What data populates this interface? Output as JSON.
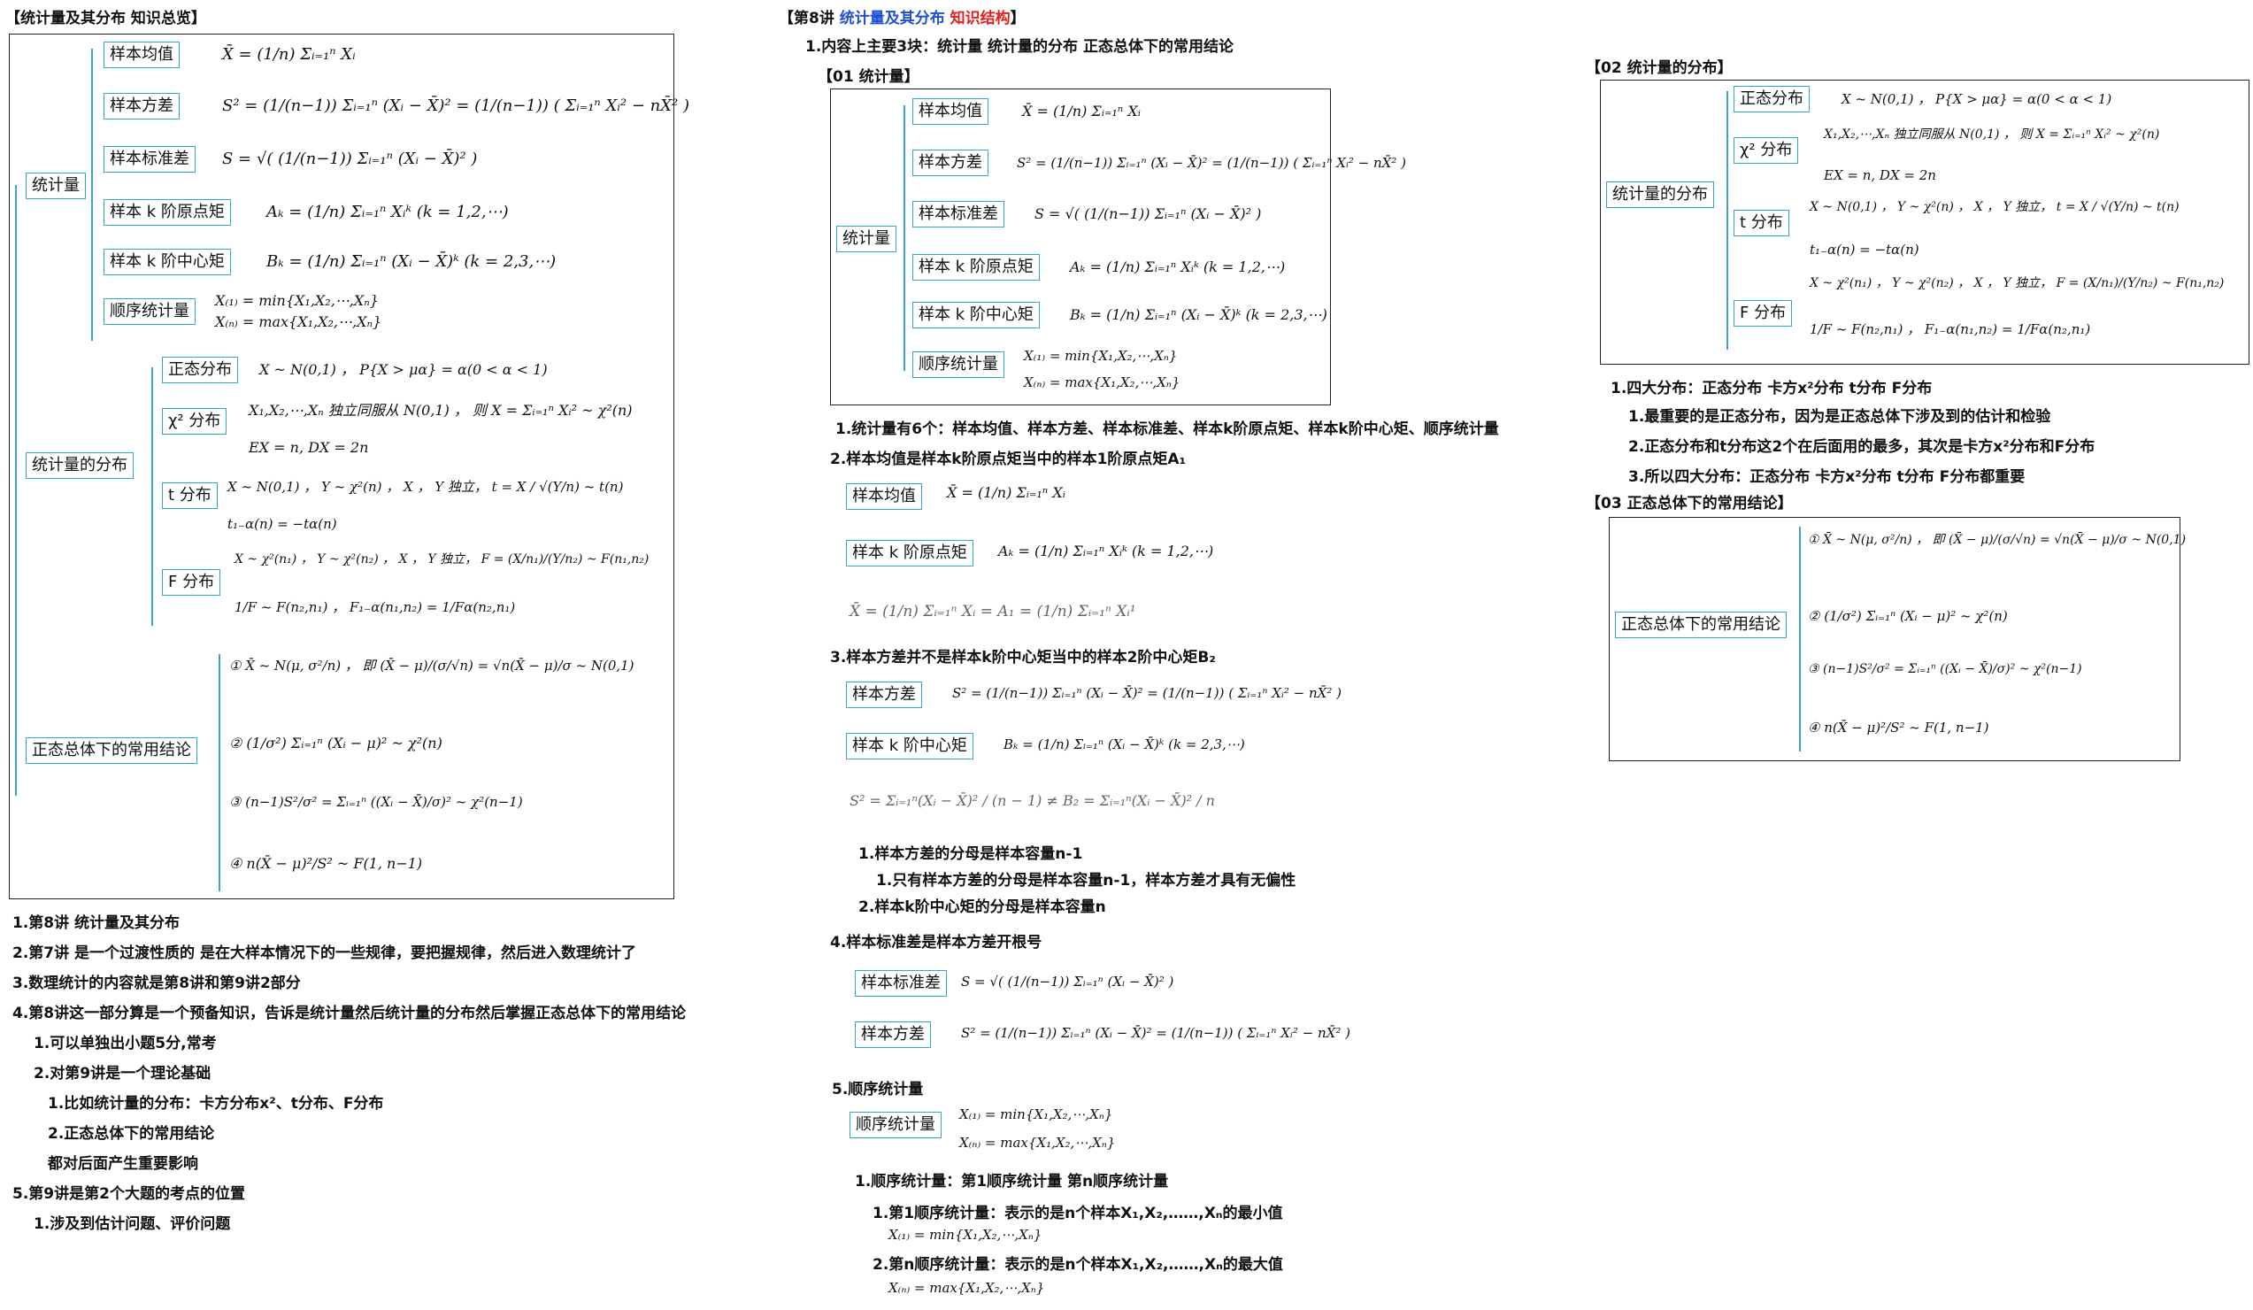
{
  "left": {
    "header": "【统计量及其分布 知识总览】",
    "tree": {
      "stat": "统计量",
      "stat_items": [
        "样本均值",
        "样本方差",
        "样本标准差",
        "样本 k 阶原点矩",
        "样本 k 阶中心矩",
        "顺序统计量"
      ],
      "stat_formulas": [
        "X̄ = (1/n) Σᵢ₌₁ⁿ Xᵢ",
        "S² = (1/(n−1)) Σᵢ₌₁ⁿ (Xᵢ − X̄)² = (1/(n−1)) ( Σᵢ₌₁ⁿ Xᵢ² − nX̄² )",
        "S = √( (1/(n−1)) Σᵢ₌₁ⁿ (Xᵢ − X̄)² )",
        "Aₖ = (1/n) Σᵢ₌₁ⁿ Xᵢᵏ (k = 1,2,⋯)",
        "Bₖ = (1/n) Σᵢ₌₁ⁿ (Xᵢ − X̄)ᵏ (k = 2,3,⋯)",
        "X₍₁₎ = min{X₁,X₂,⋯,Xₙ}",
        "X₍ₙ₎ = max{X₁,X₂,⋯,Xₙ}"
      ],
      "dist": "统计量的分布",
      "dist_items": [
        "正态分布",
        "χ² 分布",
        "t 分布",
        "F 分布"
      ],
      "dist_formulas": [
        "X ~ N(0,1) ， P{X > μα} = α(0 < α < 1)",
        "X₁,X₂,⋯,Xₙ 独立同服从 N(0,1) ， 则 X = Σᵢ₌₁ⁿ Xᵢ² ~ χ²(n)",
        "EX = n, DX = 2n",
        "X ~ N(0,1) ， Y ~ χ²(n) ， X ， Y 独立， t = X / √(Y/n) ~ t(n)",
        "t₁₋α(n) = −tα(n)",
        "X ~ χ²(n₁) ， Y ~ χ²(n₂) ， X ， Y 独立， F = (X/n₁)/(Y/n₂) ~ F(n₁,n₂)",
        "1/F ~ F(n₂,n₁) ， F₁₋α(n₁,n₂) = 1/Fα(n₂,n₁)"
      ],
      "normal": "正态总体下的常用结论",
      "normal_formulas": [
        "① X̄ ~ N(μ, σ²/n) ， 即 (X̄ − μ)/(σ/√n) = √n(X̄ − μ)/σ ~ N(0,1)",
        "② (1/σ²) Σᵢ₌₁ⁿ (Xᵢ − μ)² ~ χ²(n)",
        "③ (n−1)S²/σ² = Σᵢ₌₁ⁿ ((Xᵢ − X̄)/σ)² ~ χ²(n−1)",
        "④ n(X̄ − μ)²/S² ~ F(1, n−1)"
      ]
    },
    "notes": [
      "1.第8讲 统计量及其分布",
      "2.第7讲 是一个过渡性质的 是在大样本情况下的一些规律，要把握规律，然后进入数理统计了",
      "3.数理统计的内容就是第8讲和第9讲2部分",
      "4.第8讲这一部分算是一个预备知识，告诉是统计量然后统计量的分布然后掌握正态总体下的常用结论",
      "1.可以单独出小题5分,常考",
      "2.对第9讲是一个理论基础",
      "1.比如统计量的分布：卡方分布x²、t分布、F分布",
      "2.正态总体下的常用结论",
      "都对后面产生重要影响",
      "5.第9讲是第2个大题的考点的位置",
      "1.涉及到估计问题、评价问题"
    ]
  },
  "middle": {
    "header_a": "【第8讲 ",
    "header_b": "统计量及其分布 ",
    "header_c": "知识结构",
    "header_d": "】",
    "line1": "1.内容上主要3块：统计量 统计量的分布 正态总体下的常用结论",
    "sub01": "【01 统计量】",
    "note1": "1.统计量有6个：样本均值、样本方差、样本标准差、样本k阶原点矩、样本k阶中心矩、顺序统计量",
    "note2": "2.样本均值是样本k阶原点矩当中的样本1阶原点矩A₁",
    "eq_mean_a1": "X̄ = (1/n) Σᵢ₌₁ⁿ Xᵢ = A₁ = (1/n) Σᵢ₌₁ⁿ Xᵢ¹",
    "note3": "3.样本方差并不是样本k阶中心矩当中的样本2阶中心矩B₂",
    "eq_s2_b2": "S² = Σᵢ₌₁ⁿ(Xᵢ − X̄)² / (n − 1) ≠ B₂ = Σᵢ₌₁ⁿ(Xᵢ − X̄)² / n",
    "note3a": "1.样本方差的分母是样本容量n-1",
    "note3b": "1.只有样本方差的分母是样本容量n-1，样本方差才具有无偏性",
    "note3c": "2.样本k阶中心矩的分母是样本容量n",
    "note4": "4.样本标准差是样本方差开根号",
    "note5": "5.顺序统计量",
    "note5a": "1.顺序统计量：第1顺序统计量 第n顺序统计量",
    "note5b": "1.第1顺序统计量：表示的是n个样本X₁,X₂,……,Xₙ的最小值",
    "note5b_f": "X₍₁₎ = min{X₁,X₂,⋯,Xₙ}",
    "note5c": "2.第n顺序统计量：表示的是n个样本X₁,X₂,……,Xₙ的最大值",
    "note5c_f": "X₍ₙ₎ = max{X₁,X₂,⋯,Xₙ}"
  },
  "right": {
    "sub02": "【02 统计量的分布】",
    "r1": "1.四大分布：正态分布 卡方x²分布 t分布 F分布",
    "r2": "1.最重要的是正态分布，因为是正态总体下涉及到的估计和检验",
    "r3": "2.正态分布和t分布这2个在后面用的最多，其次是卡方x²分布和F分布",
    "r4": "3.所以四大分布：正态分布 卡方x²分布 t分布 F分布都重要",
    "sub03": "【03 正态总体下的常用结论】"
  }
}
